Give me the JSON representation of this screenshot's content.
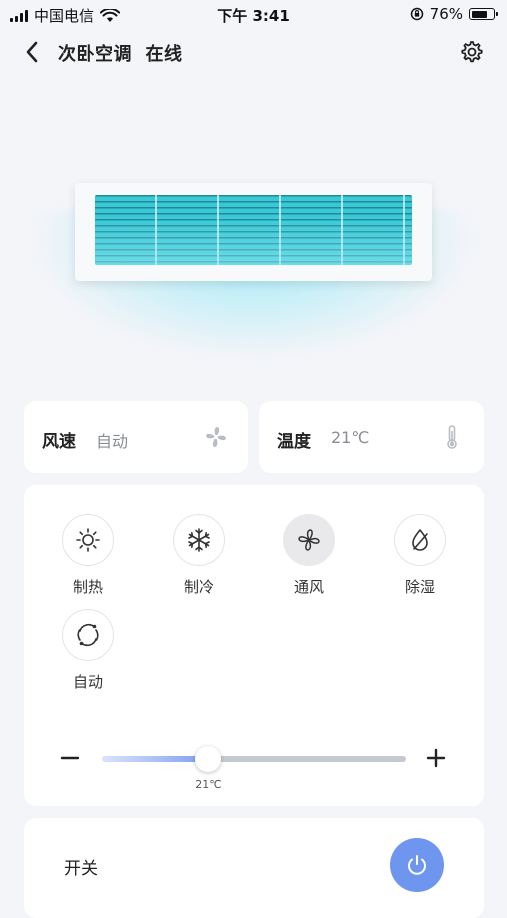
{
  "status_bar": {
    "carrier": "中国电信",
    "time": "下午 3:41",
    "battery_percent": "76%",
    "battery_level": 0.76
  },
  "header": {
    "title": "次卧空调",
    "status": "在线"
  },
  "fan_card": {
    "label": "风速",
    "value": "自动",
    "icon": "fan-icon"
  },
  "temp_card": {
    "label": "温度",
    "value": "21℃",
    "icon": "thermometer-icon"
  },
  "modes": [
    {
      "label": "制热",
      "icon": "sun-icon",
      "active": false
    },
    {
      "label": "制冷",
      "icon": "snowflake-icon",
      "active": false
    },
    {
      "label": "通风",
      "icon": "fan-icon",
      "active": true
    },
    {
      "label": "除湿",
      "icon": "droplet-icon",
      "active": false
    },
    {
      "label": "自动",
      "icon": "auto-cycle-icon",
      "active": false
    }
  ],
  "temperature_slider": {
    "value_label": "21℃",
    "fraction": 0.35
  },
  "power": {
    "label": "开关",
    "on": true
  },
  "colors": {
    "accent": "#6e96ef",
    "background": "#f4f5f9",
    "ac_air": "#37c9d8"
  }
}
